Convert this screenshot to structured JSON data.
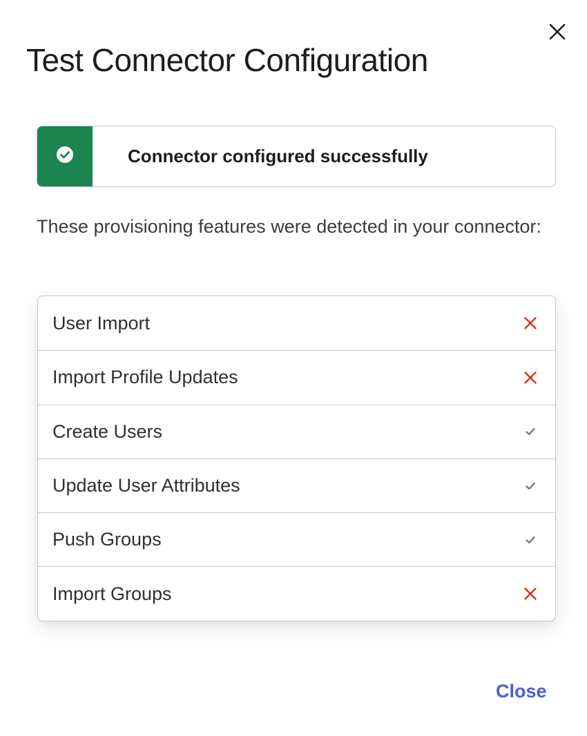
{
  "dialog": {
    "title": "Test Connector Configuration",
    "close_icon": "close-icon"
  },
  "callout": {
    "icon": "check-circle-icon",
    "message": "Connector configured successfully",
    "accent_color": "#1c844f"
  },
  "intro_text": "These provisioning features were detected in your connector:",
  "features": [
    {
      "label": "User Import",
      "status": "unsupported"
    },
    {
      "label": "Import Profile Updates",
      "status": "unsupported"
    },
    {
      "label": "Create Users",
      "status": "supported"
    },
    {
      "label": "Update User Attributes",
      "status": "supported"
    },
    {
      "label": "Push Groups",
      "status": "supported"
    },
    {
      "label": "Import Groups",
      "status": "unsupported"
    }
  ],
  "status_icons": {
    "supported": "checkmark-icon",
    "unsupported": "cross-icon"
  },
  "colors": {
    "unsupported": "#d3321c",
    "supported": "#6e6e78",
    "link": "#4b5ed7"
  },
  "footer": {
    "close_label": "Close"
  }
}
